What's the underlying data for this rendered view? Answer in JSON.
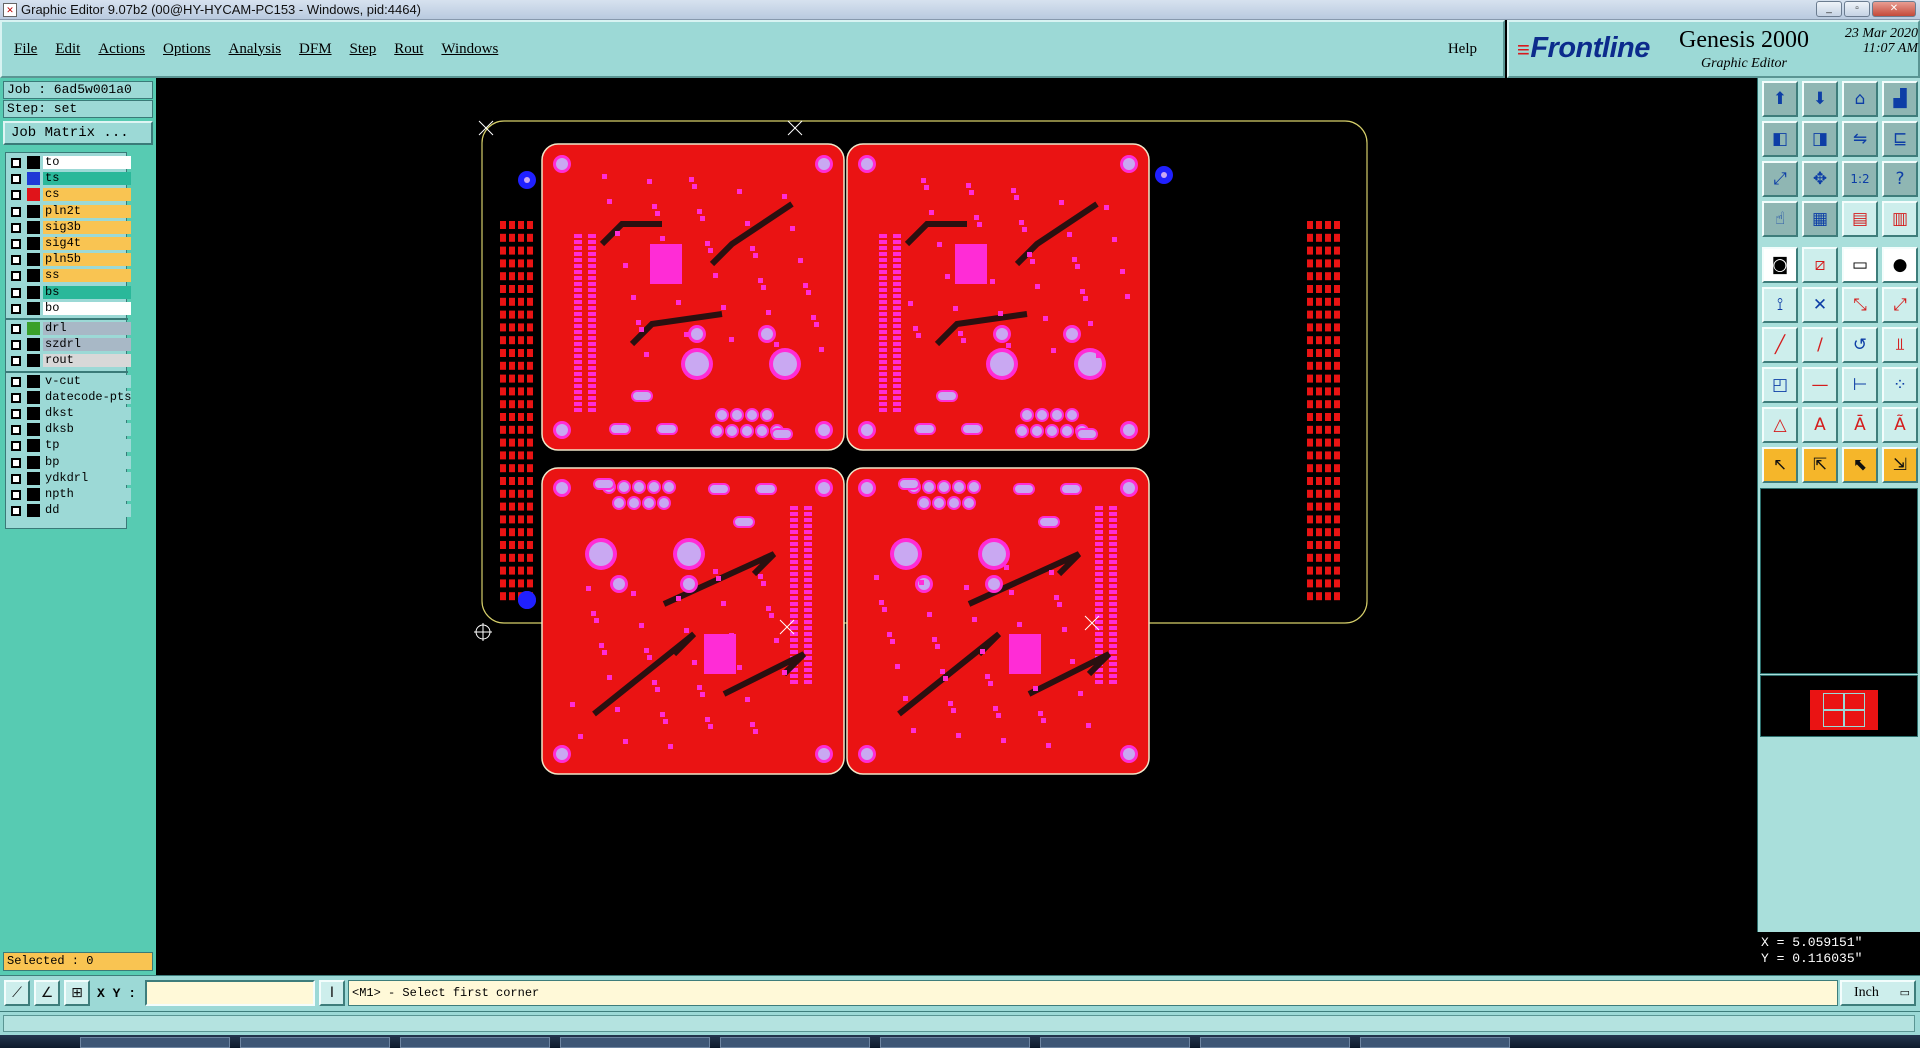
{
  "window": {
    "title": "Graphic Editor 9.07b2 (00@HY-HYCAM-PC153 - Windows, pid:4464)",
    "minimize": "_",
    "maximize": "▫",
    "close": "✕"
  },
  "menu": {
    "items": [
      {
        "label": "File"
      },
      {
        "label": "Edit"
      },
      {
        "label": "Actions"
      },
      {
        "label": "Options"
      },
      {
        "label": "Analysis"
      },
      {
        "label": "DFM"
      },
      {
        "label": "Step"
      },
      {
        "label": "Rout"
      },
      {
        "label": "Windows"
      }
    ],
    "help": "Help"
  },
  "brand": {
    "logo": "Frontline",
    "product": "Genesis 2000",
    "subtitle": "Graphic Editor",
    "date": "23 Mar 2020",
    "time": "11:07 AM"
  },
  "left_panel": {
    "job": "Job : 6ad5w001a0",
    "step": "Step: set",
    "matrix_button": "Job Matrix ...",
    "layers": [
      {
        "name": "to",
        "bg": "#ffffff",
        "swatch": "#000000"
      },
      {
        "name": "ts",
        "bg": "#2ab89a",
        "swatch": "#1f3ad6"
      },
      {
        "name": "cs",
        "bg": "#f9c452",
        "swatch": "#e0141a"
      },
      {
        "name": "pln2t",
        "bg": "#f9c452",
        "swatch": "#000000"
      },
      {
        "name": "sig3b",
        "bg": "#f9c452",
        "swatch": "#000000"
      },
      {
        "name": "sig4t",
        "bg": "#f9c452",
        "swatch": "#000000"
      },
      {
        "name": "pln5b",
        "bg": "#f9c452",
        "swatch": "#000000"
      },
      {
        "name": "ss",
        "bg": "#f9c452",
        "swatch": "#000000"
      },
      {
        "name": "bs",
        "bg": "#2ab89a",
        "swatch": "#000000"
      },
      {
        "name": "bo",
        "bg": "#ffffff",
        "swatch": "#000000"
      },
      {
        "name": "drl",
        "bg": "#a8b8c6",
        "swatch": "#3aa02a",
        "extra": "="
      },
      {
        "name": "szdrl",
        "bg": "#a8b8c6",
        "swatch": "#000000"
      },
      {
        "name": "rout",
        "bg": "#d8d8d8",
        "swatch": "#000000"
      },
      {
        "name": "v-cut",
        "bg": "#9cd9d6",
        "swatch": "#000000"
      },
      {
        "name": "datecode-pts",
        "bg": "#9cd9d6",
        "swatch": "#000000"
      },
      {
        "name": "dkst",
        "bg": "#9cd9d6",
        "swatch": "#000000"
      },
      {
        "name": "dksb",
        "bg": "#9cd9d6",
        "swatch": "#000000"
      },
      {
        "name": "tp",
        "bg": "#9cd9d6",
        "swatch": "#000000"
      },
      {
        "name": "bp",
        "bg": "#9cd9d6",
        "swatch": "#000000"
      },
      {
        "name": "ydkdrl",
        "bg": "#9cd9d6",
        "swatch": "#000000"
      },
      {
        "name": "npth",
        "bg": "#9cd9d6",
        "swatch": "#000000"
      },
      {
        "name": "dd",
        "bg": "#9cd9d6",
        "swatch": "#000000"
      }
    ],
    "selected": "Selected : 0"
  },
  "tools": [
    {
      "name": "open-step-icon",
      "glyph": "⬆",
      "style": "dark"
    },
    {
      "name": "save-step-icon",
      "glyph": "⬇",
      "style": "dark"
    },
    {
      "name": "home-icon",
      "glyph": "⌂",
      "style": "dark"
    },
    {
      "name": "window-split-icon",
      "glyph": "▟",
      "style": "dark"
    },
    {
      "name": "zoom-left-icon",
      "glyph": "◧",
      "style": "dark"
    },
    {
      "name": "zoom-right-icon",
      "glyph": "◨",
      "style": "dark"
    },
    {
      "name": "mirror-icon",
      "glyph": "⇋",
      "style": "dark"
    },
    {
      "name": "snap-icon",
      "glyph": "⊑",
      "style": "dark"
    },
    {
      "name": "zoom-fit-icon",
      "glyph": "⤢",
      "style": "dark"
    },
    {
      "name": "zoom-home-icon",
      "glyph": "✥",
      "style": "dark"
    },
    {
      "name": "scale-1-2-icon",
      "glyph": "1:2",
      "style": "dark"
    },
    {
      "name": "help-icon",
      "glyph": "?",
      "style": "dark"
    },
    {
      "name": "pan-icon",
      "glyph": "☝",
      "style": "dark"
    },
    {
      "name": "grid-icon",
      "glyph": "▦",
      "style": "dark"
    },
    {
      "name": "layers-red-icon",
      "glyph": "▤",
      "style": "red"
    },
    {
      "name": "net-icon",
      "glyph": "▥",
      "style": "red"
    },
    {
      "name": "pad-icon",
      "glyph": "◙",
      "style": "box"
    },
    {
      "name": "line-draw-icon",
      "glyph": "⧄",
      "style": "red"
    },
    {
      "name": "ruler-icon",
      "glyph": "▭",
      "style": "box"
    },
    {
      "name": "circle-fill-icon",
      "glyph": "●",
      "style": "box"
    },
    {
      "name": "connect-nodes-icon",
      "glyph": "⟟",
      "style": ""
    },
    {
      "name": "cross-node-icon",
      "glyph": "✕",
      "style": ""
    },
    {
      "name": "line-node-icon",
      "glyph": "⤡",
      "style": "red"
    },
    {
      "name": "move-node-icon",
      "glyph": "⤢",
      "style": "red"
    },
    {
      "name": "add-line-icon",
      "glyph": "╱",
      "style": "red"
    },
    {
      "name": "slash-icon",
      "glyph": "/",
      "style": "red"
    },
    {
      "name": "arc-icon",
      "glyph": "↺",
      "style": ""
    },
    {
      "name": "fork-icon",
      "glyph": "⫫",
      "style": "red"
    },
    {
      "name": "square-node-icon",
      "glyph": "◰",
      "style": ""
    },
    {
      "name": "dash-icon",
      "glyph": "—",
      "style": "red"
    },
    {
      "name": "measure-icon",
      "glyph": "⊢",
      "style": ""
    },
    {
      "name": "pads-icon",
      "glyph": "⁘",
      "style": ""
    },
    {
      "name": "triangle-icon",
      "glyph": "△",
      "style": "red"
    },
    {
      "name": "text-a-icon",
      "glyph": "A",
      "style": "red"
    },
    {
      "name": "a-bar-icon",
      "glyph": "Ā",
      "style": "red"
    },
    {
      "name": "a-arc-icon",
      "glyph": "Ã",
      "style": "red"
    },
    {
      "name": "select-arrow-icon",
      "glyph": "↖",
      "style": "yellow"
    },
    {
      "name": "select-box-icon",
      "glyph": "⇱",
      "style": "yellow"
    },
    {
      "name": "select-circle-icon",
      "glyph": "⬉",
      "style": "yellow"
    },
    {
      "name": "select-route-icon",
      "glyph": "⇲",
      "style": "yellow"
    }
  ],
  "coordinates": {
    "x": "X = 5.059151\"",
    "y": "Y = 0.116035\""
  },
  "status": {
    "xy_label": "X Y :",
    "xy_value": "",
    "prompt": "<M1> - Select first corner",
    "units": "Inch"
  },
  "colors": {
    "board": "#ea1313",
    "pad": "#ff2cd6",
    "via": "#c9a8f2",
    "fiducial": "#2020ff",
    "panel_bg": "#9cd9d6"
  }
}
